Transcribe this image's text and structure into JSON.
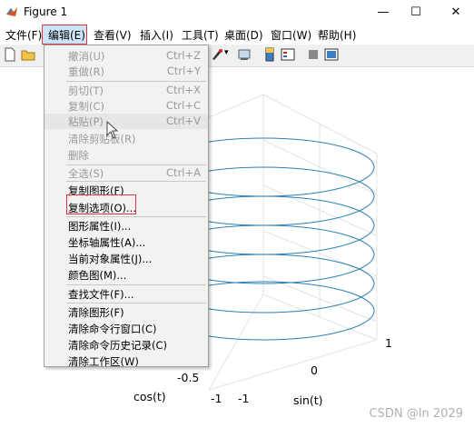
{
  "window": {
    "title": "Figure 1",
    "controls": [
      "—",
      "☐",
      "✕"
    ]
  },
  "menubar": [
    "文件(F)",
    "编辑(E)",
    "查看(V)",
    "插入(I)",
    "工具(T)",
    "桌面(D)",
    "窗口(W)",
    "帮助(H)"
  ],
  "edit_menu": {
    "items": [
      {
        "label": "撤消(U)",
        "shortcut": "Ctrl+Z",
        "enabled": false
      },
      {
        "label": "重做(R)",
        "shortcut": "Ctrl+Y",
        "enabled": false
      },
      {
        "label": "剪切(T)",
        "shortcut": "Ctrl+X",
        "enabled": false
      },
      {
        "label": "复制(C)",
        "shortcut": "Ctrl+C",
        "enabled": false
      },
      {
        "label": "粘贴(P)",
        "shortcut": "Ctrl+V",
        "enabled": false
      },
      {
        "label": "清除剪贴板(R)",
        "shortcut": "",
        "enabled": false
      },
      {
        "label": "删除",
        "shortcut": "",
        "enabled": false
      },
      {
        "label": "全选(S)",
        "shortcut": "Ctrl+A",
        "enabled": false
      },
      {
        "label": "复制图形(F)",
        "shortcut": "",
        "enabled": true
      },
      {
        "label": "复制选项(O)...",
        "shortcut": "",
        "enabled": true
      },
      {
        "label": "图形属性(I)...",
        "shortcut": "",
        "enabled": true
      },
      {
        "label": "坐标轴属性(A)...",
        "shortcut": "",
        "enabled": true
      },
      {
        "label": "当前对象属性(J)...",
        "shortcut": "",
        "enabled": true
      },
      {
        "label": "颜色图(M)...",
        "shortcut": "",
        "enabled": true
      },
      {
        "label": "查找文件(F)...",
        "shortcut": "",
        "enabled": true
      },
      {
        "label": "清除图形(F)",
        "shortcut": "",
        "enabled": true
      },
      {
        "label": "清除命令行窗口(C)",
        "shortcut": "",
        "enabled": true
      },
      {
        "label": "清除命令历史记录(C)",
        "shortcut": "",
        "enabled": true
      },
      {
        "label": "清除工作区(W)",
        "shortcut": "",
        "enabled": true
      }
    ]
  },
  "plot": {
    "type": "helix",
    "x_label": "cos(t)",
    "y_label": "sin(t)",
    "x_ticks": [
      "-1",
      "-0.5"
    ],
    "y_ticks": [
      "-1",
      "0",
      "1"
    ],
    "line_color": "#2f80b5"
  },
  "watermark": "CSDN @In 2029",
  "colors": {
    "accent_border": "#d9363e",
    "menu_bg": "#f2f2f2",
    "line": "#2f80b5"
  }
}
